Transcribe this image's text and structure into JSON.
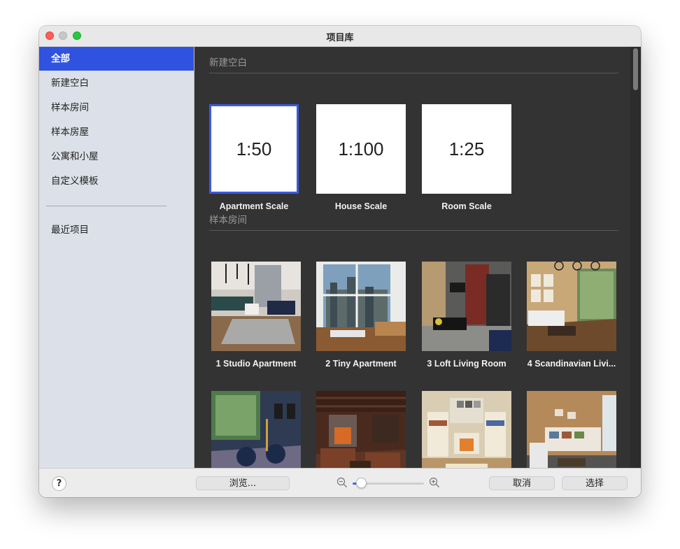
{
  "window": {
    "title": "项目库"
  },
  "sidebar": {
    "items": [
      {
        "label": "全部",
        "active": true
      },
      {
        "label": "新建空白"
      },
      {
        "label": "样本房间"
      },
      {
        "label": "样本房屋"
      },
      {
        "label": "公寓和小屋"
      },
      {
        "label": "自定义模板"
      }
    ],
    "recent_label": "最近项目"
  },
  "sections": {
    "new_blank": {
      "title": "新建空白",
      "scales": [
        {
          "value": "1:50",
          "caption": "Apartment Scale",
          "selected": true
        },
        {
          "value": "1:100",
          "caption": "House Scale"
        },
        {
          "value": "1:25",
          "caption": "Room Scale"
        }
      ]
    },
    "sample_rooms": {
      "title": "样本房间",
      "rooms": [
        {
          "caption": "1 Studio Apartment"
        },
        {
          "caption": "2 Tiny Apartment"
        },
        {
          "caption": "3 Loft Living Room"
        },
        {
          "caption": "4 Scandinavian Livi..."
        },
        {
          "caption": ""
        },
        {
          "caption": ""
        },
        {
          "caption": ""
        },
        {
          "caption": ""
        }
      ]
    }
  },
  "bottombar": {
    "help": "?",
    "browse": "浏览...",
    "cancel": "取消",
    "select": "选择",
    "zoom_level": 0.12
  },
  "colors": {
    "accent": "#2f52e0",
    "content_bg": "#333333",
    "sidebar_bg": "#dce1e9"
  }
}
